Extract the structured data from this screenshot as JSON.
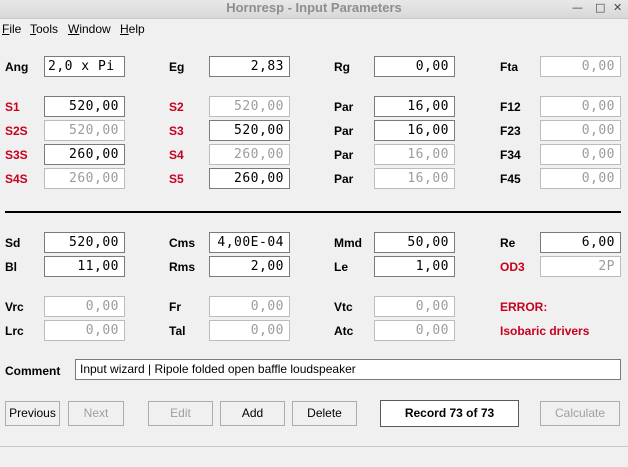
{
  "window": {
    "title": "Hornresp - Input Parameters",
    "minimize_glyph": "—",
    "maximize_glyph": "□",
    "close_glyph": "✕"
  },
  "menu": [
    {
      "label": "File",
      "accel": "F",
      "rest": "ile"
    },
    {
      "label": "Tools",
      "accel": "T",
      "rest": "ools"
    },
    {
      "label": "Window",
      "accel": "W",
      "rest": "indow"
    },
    {
      "label": "Help",
      "accel": "H",
      "rest": "elp"
    }
  ],
  "params": {
    "ang": {
      "label": "Ang",
      "value": "2,0 x Pi"
    },
    "eg": {
      "label": "Eg",
      "value": "2,83"
    },
    "rg": {
      "label": "Rg",
      "value": "0,00"
    },
    "fta": {
      "label": "Fta",
      "value": "0,00"
    },
    "s1": {
      "label": "S1",
      "value": "520,00"
    },
    "s2": {
      "label": "S2",
      "value": "520,00"
    },
    "par1": {
      "label": "Par",
      "value": "16,00"
    },
    "f12": {
      "label": "F12",
      "value": "0,00"
    },
    "s2s": {
      "label": "S2S",
      "value": "520,00"
    },
    "s3": {
      "label": "S3",
      "value": "520,00"
    },
    "par2": {
      "label": "Par",
      "value": "16,00"
    },
    "f23": {
      "label": "F23",
      "value": "0,00"
    },
    "s3s": {
      "label": "S3S",
      "value": "260,00"
    },
    "s4": {
      "label": "S4",
      "value": "260,00"
    },
    "par3": {
      "label": "Par",
      "value": "16,00"
    },
    "f34": {
      "label": "F34",
      "value": "0,00"
    },
    "s4s": {
      "label": "S4S",
      "value": "260,00"
    },
    "s5": {
      "label": "S5",
      "value": "260,00"
    },
    "par4": {
      "label": "Par",
      "value": "16,00"
    },
    "f45": {
      "label": "F45",
      "value": "0,00"
    },
    "sd": {
      "label": "Sd",
      "value": "520,00"
    },
    "cms": {
      "label": "Cms",
      "value": "4,00E-04"
    },
    "mmd": {
      "label": "Mmd",
      "value": "50,00"
    },
    "re": {
      "label": "Re",
      "value": "6,00"
    },
    "bl": {
      "label": "Bl",
      "value": "11,00"
    },
    "rms": {
      "label": "Rms",
      "value": "2,00"
    },
    "le": {
      "label": "Le",
      "value": "1,00"
    },
    "od3": {
      "label": "OD3",
      "value": "2P"
    },
    "vrc": {
      "label": "Vrc",
      "value": "0,00"
    },
    "fr": {
      "label": "Fr",
      "value": "0,00"
    },
    "vtc": {
      "label": "Vtc",
      "value": "0,00"
    },
    "lrc": {
      "label": "Lrc",
      "value": "0,00"
    },
    "tal": {
      "label": "Tal",
      "value": "0,00"
    },
    "atc": {
      "label": "Atc",
      "value": "0,00"
    }
  },
  "error": {
    "label": "ERROR:",
    "message": "Isobaric drivers"
  },
  "comment": {
    "label": "Comment",
    "value": "Input wizard | Ripole folded open baffle loudspeaker"
  },
  "buttons": {
    "previous": "Previous",
    "next": "Next",
    "edit": "Edit",
    "add": "Add",
    "delete": "Delete",
    "calculate": "Calculate"
  },
  "record": "Record 73 of 73",
  "colors": {
    "red_label": "#c8001e",
    "disabled_text": "#9c9c9c"
  }
}
